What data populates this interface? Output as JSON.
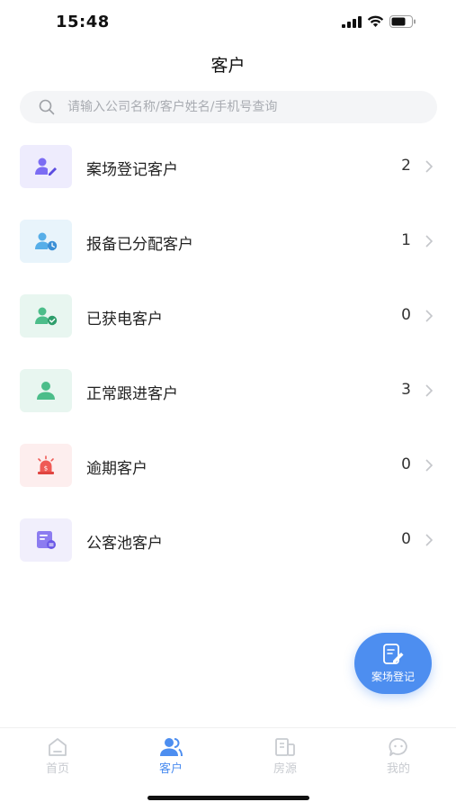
{
  "status": {
    "time": "15:48"
  },
  "header": {
    "title": "客户"
  },
  "search": {
    "placeholder": "请输入公司名称/客户姓名/手机号查询"
  },
  "rows": [
    {
      "label": "案场登记客户",
      "count": "2",
      "icon": "user-edit-icon",
      "bg": "#eeecfd",
      "fg": "#7b6cf3"
    },
    {
      "label": "报备已分配客户",
      "count": "1",
      "icon": "user-clock-icon",
      "bg": "#e8f4fb",
      "fg": "#56aee8"
    },
    {
      "label": "已获电客户",
      "count": "0",
      "icon": "user-check-icon",
      "bg": "#e8f6f0",
      "fg": "#4cbd8a"
    },
    {
      "label": "正常跟进客户",
      "count": "3",
      "icon": "user-icon",
      "bg": "#e8f6f0",
      "fg": "#4cbd8a"
    },
    {
      "label": "逾期客户",
      "count": "0",
      "icon": "alarm-icon",
      "bg": "#fdeeee",
      "fg": "#ef5a55"
    },
    {
      "label": "公客池客户",
      "count": "0",
      "icon": "form-icon",
      "bg": "#f1effc",
      "fg": "#8c7cf0"
    }
  ],
  "fab": {
    "label": "案场登记"
  },
  "tabs": [
    {
      "label": "首页",
      "icon": "home-icon",
      "active": false
    },
    {
      "label": "客户",
      "icon": "customers-icon",
      "active": true
    },
    {
      "label": "房源",
      "icon": "building-icon",
      "active": false
    },
    {
      "label": "我的",
      "icon": "chat-face-icon",
      "active": false
    }
  ],
  "colors": {
    "accent": "#4d8ef0",
    "tab_inactive": "#c8cbd0"
  }
}
